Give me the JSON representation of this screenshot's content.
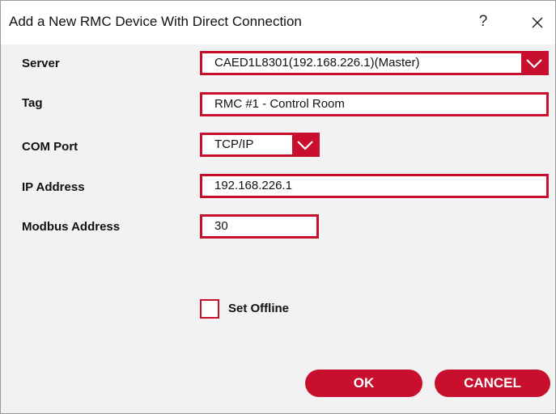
{
  "window": {
    "title": "Add a New RMC Device With Direct Connection",
    "help_label": "?",
    "close_icon": "close-icon"
  },
  "form": {
    "server": {
      "label": "Server",
      "value": "CAED1L8301(192.168.226.1)(Master)"
    },
    "tag": {
      "label": "Tag",
      "value": "RMC #1 - Control Room"
    },
    "com_port": {
      "label": "COM Port",
      "value": "TCP/IP"
    },
    "ip_address": {
      "label": "IP Address",
      "value": "192.168.226.1"
    },
    "modbus_address": {
      "label": "Modbus Address",
      "value": "30"
    },
    "set_offline": {
      "label": "Set Offline",
      "checked": false
    }
  },
  "actions": {
    "ok_label": "OK",
    "cancel_label": "CANCEL"
  },
  "colors": {
    "accent": "#c8102e",
    "background": "#f2f2f2",
    "titlebar": "#ffffff"
  }
}
